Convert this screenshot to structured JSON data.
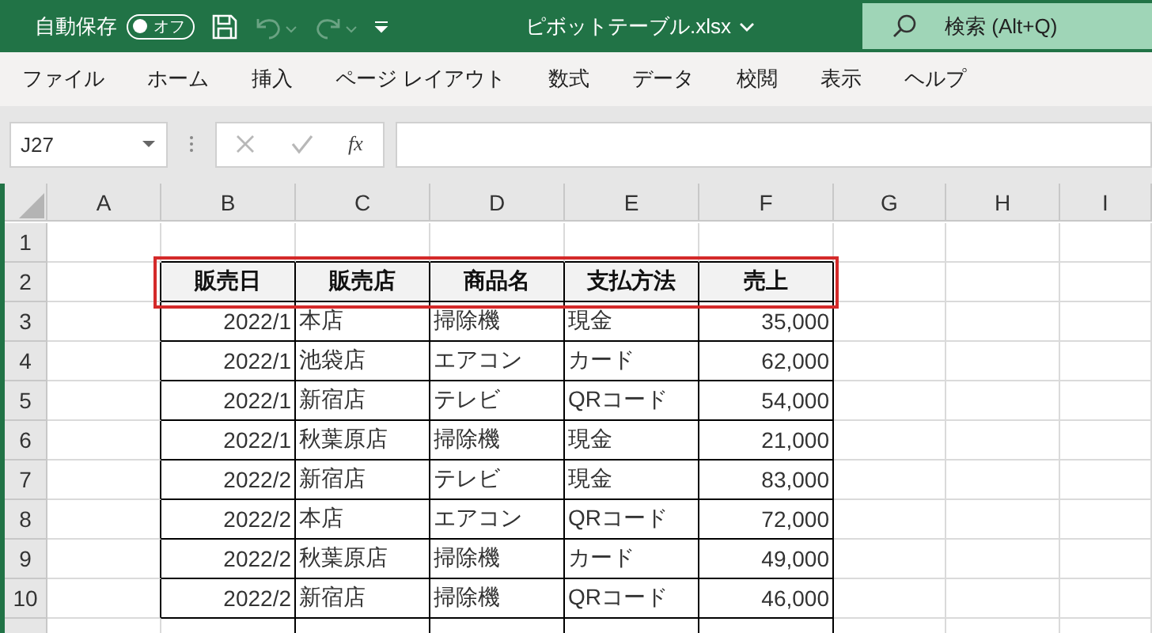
{
  "title_bar": {
    "autosave_label": "自動保存",
    "autosave_toggle": {
      "label": "オフ",
      "on": false
    },
    "quick_access": [
      {
        "kind": "save",
        "disabled": false
      },
      {
        "kind": "undo",
        "disabled": true
      },
      {
        "kind": "redo",
        "disabled": true
      },
      {
        "kind": "customize",
        "disabled": false
      }
    ],
    "filename": "ピボットテーブル.xlsx",
    "search": {
      "placeholder": "検索 (Alt+Q)"
    }
  },
  "ribbon_tabs": [
    "ファイル",
    "ホーム",
    "挿入",
    "ページ レイアウト",
    "数式",
    "データ",
    "校閲",
    "表示",
    "ヘルプ"
  ],
  "formula_bar": {
    "name_box": "J27",
    "buttons": [
      {
        "kind": "cancel",
        "disabled": true
      },
      {
        "kind": "enter",
        "disabled": true
      }
    ],
    "function_label": "fx"
  },
  "sheet": {
    "columns": [
      "A",
      "B",
      "C",
      "D",
      "E",
      "F",
      "G",
      "H",
      "I"
    ],
    "row_numbers": [
      "1",
      "2",
      "3",
      "4",
      "5",
      "6",
      "7",
      "8",
      "9",
      "10"
    ],
    "table": {
      "highlighted": true,
      "header": [
        {
          "label": "販売日",
          "kind": "number"
        },
        {
          "label": "販売店",
          "kind": "text"
        },
        {
          "label": "商品名",
          "kind": "text"
        },
        {
          "label": "支払方法",
          "kind": "text"
        },
        {
          "label": "売上",
          "kind": "number"
        }
      ],
      "rows": [
        [
          "2022/1",
          "本店",
          "掃除機",
          "現金",
          "35,000"
        ],
        [
          "2022/1",
          "池袋店",
          "エアコン",
          "カード",
          "62,000"
        ],
        [
          "2022/1",
          "新宿店",
          "テレビ",
          "QRコード",
          "54,000"
        ],
        [
          "2022/1",
          "秋葉原店",
          "掃除機",
          "現金",
          "21,000"
        ],
        [
          "2022/2",
          "新宿店",
          "テレビ",
          "現金",
          "83,000"
        ],
        [
          "2022/2",
          "本店",
          "エアコン",
          "QRコード",
          "72,000"
        ],
        [
          "2022/2",
          "秋葉原店",
          "掃除機",
          "カード",
          "49,000"
        ],
        [
          "2022/2",
          "新宿店",
          "掃除機",
          "QRコード",
          "46,000"
        ]
      ]
    }
  }
}
